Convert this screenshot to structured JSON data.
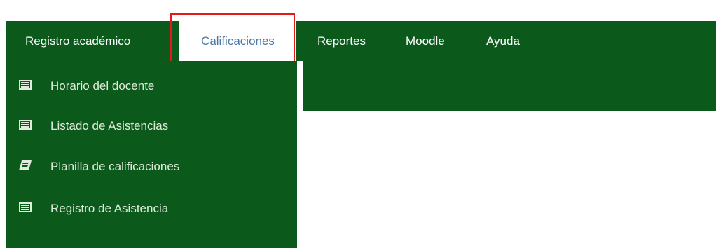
{
  "navbar": {
    "items": [
      {
        "label": "Registro académico",
        "active": false
      },
      {
        "label": "Calificaciones",
        "active": true
      },
      {
        "label": "Reportes",
        "active": false
      },
      {
        "label": "Moodle",
        "active": false
      },
      {
        "label": "Ayuda",
        "active": false
      }
    ]
  },
  "dropdown": {
    "items": [
      {
        "label": "Horario del docente",
        "icon": "list-icon"
      },
      {
        "label": "Listado de Asistencias",
        "icon": "list-icon"
      },
      {
        "label": "Planilla de calificaciones",
        "icon": "book-icon"
      },
      {
        "label": "Registro de Asistencia",
        "icon": "list-icon"
      }
    ]
  },
  "colors": {
    "brand_green": "#0b5a1c",
    "active_text": "#4a79a8",
    "highlight": "#e11b1b"
  }
}
